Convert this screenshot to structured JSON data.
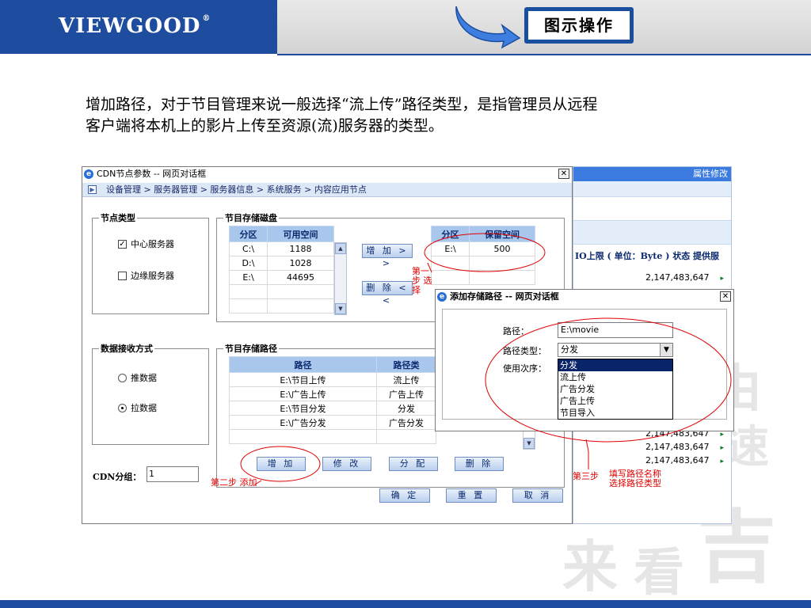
{
  "header": {
    "logo": "VIEWGOOD",
    "logo_mark": "®",
    "badge": "图示操作"
  },
  "intro": {
    "line1": "增加路径，对于节目管理来说一般选择“流上传”路径类型，是指管理员从远程",
    "line2": "客户端将本机上的影片上传至资源(流)服务器的类型。"
  },
  "main_dialog": {
    "title": "CDN节点参数 -- 网页对话框",
    "breadcrumb": "设备管理 > 服务器管理 > 服务器信息 > 系统服务 > 内容应用节点",
    "node_type": {
      "legend": "节点类型",
      "center": "中心服务器",
      "edge": "边缘服务器"
    },
    "storage_disks": {
      "legend": "节目存储磁盘",
      "available": {
        "headers": [
          "分区",
          "可用空间"
        ],
        "rows": [
          [
            "C:\\",
            "1188"
          ],
          [
            "D:\\",
            "1028"
          ],
          [
            "E:\\",
            "44695"
          ]
        ]
      },
      "reserved": {
        "headers": [
          "分区",
          "保留空间"
        ],
        "rows": [
          [
            "E:\\",
            "500"
          ]
        ]
      },
      "add_btn": "增 加 > >",
      "del_btn": "删 除 < <"
    },
    "receive_mode": {
      "legend": "数据接收方式",
      "push": "推数据",
      "pull": "拉数据"
    },
    "storage_paths": {
      "legend": "节目存储路径",
      "headers": [
        "路径",
        "路径类"
      ],
      "rows": [
        [
          "E:\\节目上传",
          "流上传"
        ],
        [
          "E:\\广告上传",
          "广告上传"
        ],
        [
          "E:\\节目分发",
          "分发"
        ],
        [
          "E:\\广告分发",
          "广告分发"
        ]
      ],
      "buttons": [
        "增 加",
        "修 改",
        "分 配",
        "删 除"
      ]
    },
    "cdn_group_label": "CDN分组：",
    "cdn_group_value": "1",
    "footer_buttons": [
      "确 定",
      "重 置",
      "取 消"
    ]
  },
  "background_page": {
    "tab_label": "属性修改",
    "columns_header": "IO上限 ( 单位：Byte ) 状态 提供服",
    "rows": [
      "2,147,483,647",
      "2,147,483,647",
      "2,147,483,647",
      "2,147,483,647"
    ],
    "row_marker": "▸"
  },
  "add_dialog": {
    "title": "添加存储路径 -- 网页对话框",
    "path_label": "路径：",
    "path_value": "E:\\movie",
    "type_label": "路径类型：",
    "type_value": "分发",
    "order_label": "使用次序：",
    "options": [
      "分发",
      "流上传",
      "广告分发",
      "广告上传",
      "节目导入"
    ]
  },
  "annotations": {
    "step1": [
      "第一",
      "步 选",
      "择"
    ],
    "step2": "第二步 添加",
    "step3_label": "第三步",
    "step3_text1": "填写路径名称",
    "step3_text2": "选择路径类型"
  },
  "watermark": [
    "由",
    "速",
    "吉",
    "来",
    "看"
  ],
  "colors": {
    "brand_blue": "#1e4da0",
    "annotation_red": "#e00000",
    "grid_header": "#a9c7ec",
    "selection": "#0a246a"
  }
}
